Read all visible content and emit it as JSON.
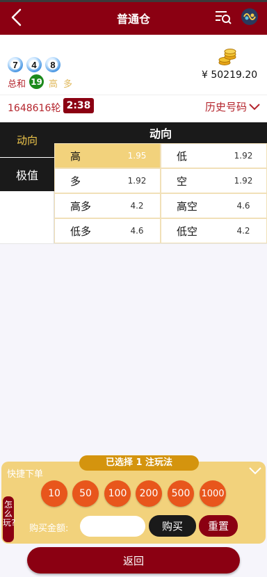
{
  "header": {
    "title": "普通仓"
  },
  "draw": {
    "balls": [
      "7",
      "4",
      "8"
    ],
    "sum_label": "总和",
    "sum_value": "19",
    "tags": [
      "高",
      "多"
    ]
  },
  "account": {
    "balance": "¥ 50219.20"
  },
  "round": {
    "number": "1648616轮",
    "timer": "2:38",
    "history_label": "历史号码"
  },
  "side_tabs": [
    {
      "label": "动向"
    },
    {
      "label": "极值"
    }
  ],
  "grid": {
    "header": "动向",
    "rows": [
      [
        {
          "label": "高",
          "odds": "1.95"
        },
        {
          "label": "低",
          "odds": "1.92"
        }
      ],
      [
        {
          "label": "多",
          "odds": "1.92"
        },
        {
          "label": "空",
          "odds": "1.92"
        }
      ],
      [
        {
          "label": "高多",
          "odds": "4.2"
        },
        {
          "label": "高空",
          "odds": "4.6"
        }
      ],
      [
        {
          "label": "低多",
          "odds": "4.6"
        },
        {
          "label": "低空",
          "odds": "4.2"
        }
      ]
    ],
    "selected": "高"
  },
  "bet_panel": {
    "selected_text": "已选择 1 注玩法",
    "quick_label": "快捷下单",
    "chips": [
      "10",
      "50",
      "100",
      "200",
      "500",
      "1000"
    ],
    "how_to_play": "怎么玩?",
    "amount_label": "购买金额:",
    "amount_value": "",
    "buy_label": "购买",
    "reset_label": "重置"
  },
  "footer": {
    "return_label": "返回"
  },
  "colors": {
    "brand": "#8b0012",
    "gold": "#f2d27c",
    "chip": "#e8561c",
    "dark": "#1a1a1a"
  }
}
